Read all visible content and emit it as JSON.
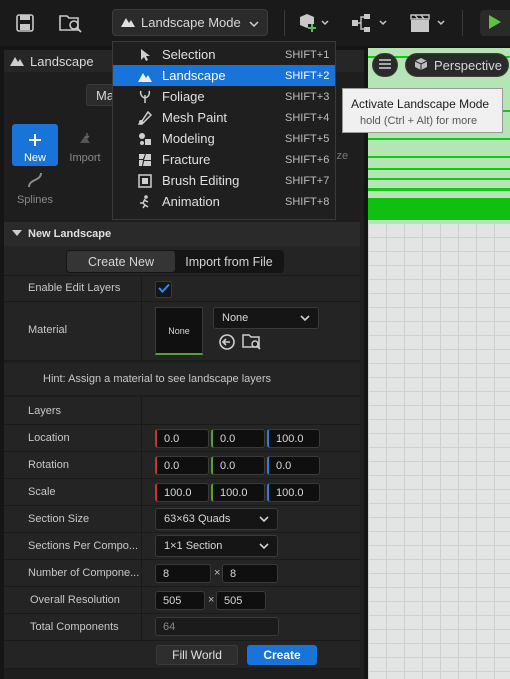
{
  "toolbar": {
    "mode_label": "Landscape Mode",
    "icons": [
      "save-icon",
      "content-browser-icon",
      "add-actor-icon",
      "blueprint-icon",
      "cinematics-icon",
      "play-icon"
    ]
  },
  "panel": {
    "title": "Landscape",
    "manage_label": "Manage",
    "tools": [
      {
        "label": "New",
        "active": true
      },
      {
        "label": "Import",
        "active": false
      },
      {
        "label": "Splines",
        "active": false
      },
      {
        "label": "ize",
        "active": false
      }
    ],
    "section_title": "New Landscape",
    "segments": [
      "Create New",
      "Import from File"
    ],
    "labels": {
      "enable_edit_layers": "Enable Edit Layers",
      "material": "Material",
      "layers": "Layers",
      "location": "Location",
      "rotation": "Rotation",
      "scale": "Scale",
      "section_size": "Section Size",
      "sections_per_component": "Sections Per Compo...",
      "number_of_components": "Number of Compone...",
      "overall_resolution": "Overall Resolution",
      "total_components": "Total Components"
    },
    "enable_edit_layers": true,
    "material": {
      "thumb_label": "None",
      "selected": "None"
    },
    "hint": "Hint: Assign a material to see landscape layers",
    "location": [
      "0.0",
      "0.0",
      "100.0"
    ],
    "rotation": [
      "0.0",
      "0.0",
      "0.0"
    ],
    "scale": [
      "100.0",
      "100.0",
      "100.0"
    ],
    "section_size": "63×63 Quads",
    "sections_per_component": "1×1 Section",
    "number_of_components": [
      "8",
      "8"
    ],
    "overall_resolution": [
      "505",
      "505"
    ],
    "total_components": "64",
    "times_symbol": "×",
    "fill_world_label": "Fill World",
    "create_label": "Create"
  },
  "menu": {
    "items": [
      {
        "label": "Selection",
        "shortcut": "SHIFT+1",
        "icon": "selection-icon",
        "active": false
      },
      {
        "label": "Landscape",
        "shortcut": "SHIFT+2",
        "icon": "landscape-icon",
        "active": true
      },
      {
        "label": "Foliage",
        "shortcut": "SHIFT+3",
        "icon": "foliage-icon",
        "active": false
      },
      {
        "label": "Mesh Paint",
        "shortcut": "SHIFT+4",
        "icon": "mesh-paint-icon",
        "active": false
      },
      {
        "label": "Modeling",
        "shortcut": "SHIFT+5",
        "icon": "modeling-icon",
        "active": false
      },
      {
        "label": "Fracture",
        "shortcut": "SHIFT+6",
        "icon": "fracture-icon",
        "active": false
      },
      {
        "label": "Brush Editing",
        "shortcut": "SHIFT+7",
        "icon": "brush-editing-icon",
        "active": false
      },
      {
        "label": "Animation",
        "shortcut": "SHIFT+8",
        "icon": "animation-icon",
        "active": false
      }
    ]
  },
  "tooltip": {
    "title": "Activate Landscape Mode",
    "subtitle": "hold (Ctrl + Alt) for more"
  },
  "viewport": {
    "view_label": "Perspective"
  },
  "colors": {
    "accent": "#1874d8",
    "axis_x": "#c0392b",
    "axis_y": "#5aa02c",
    "axis_z": "#2f7ed8",
    "landscape_grid": "#12c812"
  }
}
